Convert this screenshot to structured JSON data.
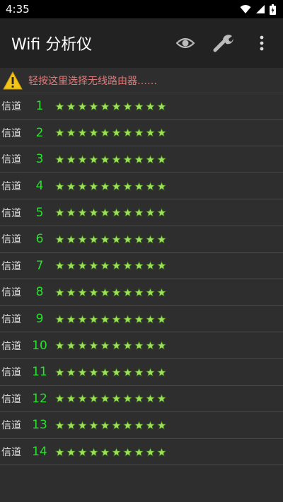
{
  "status_bar": {
    "time": "4:35",
    "icons": [
      "wifi-icon",
      "signal-icon",
      "battery-icon"
    ]
  },
  "app_bar": {
    "title": "Wifi 分析仪",
    "actions": [
      "eye-icon",
      "wrench-icon",
      "more-vert-icon"
    ]
  },
  "hint": {
    "icon": "warning-icon",
    "text": "轻按这里选择无线路由器……",
    "text_color": "#e07a7a"
  },
  "colors": {
    "background": "#2e2e2e",
    "app_bar": "#222222",
    "channel_number": "#29e02e",
    "star": "#9be05a"
  },
  "channels": [
    {
      "label": "信道",
      "number": "1",
      "stars": 10
    },
    {
      "label": "信道",
      "number": "2",
      "stars": 10
    },
    {
      "label": "信道",
      "number": "3",
      "stars": 10
    },
    {
      "label": "信道",
      "number": "4",
      "stars": 10
    },
    {
      "label": "信道",
      "number": "5",
      "stars": 10
    },
    {
      "label": "信道",
      "number": "6",
      "stars": 10
    },
    {
      "label": "信道",
      "number": "7",
      "stars": 10
    },
    {
      "label": "信道",
      "number": "8",
      "stars": 10
    },
    {
      "label": "信道",
      "number": "9",
      "stars": 10
    },
    {
      "label": "信道",
      "number": "10",
      "stars": 10
    },
    {
      "label": "信道",
      "number": "11",
      "stars": 10
    },
    {
      "label": "信道",
      "number": "12",
      "stars": 10
    },
    {
      "label": "信道",
      "number": "13",
      "stars": 10
    },
    {
      "label": "信道",
      "number": "14",
      "stars": 10
    }
  ]
}
